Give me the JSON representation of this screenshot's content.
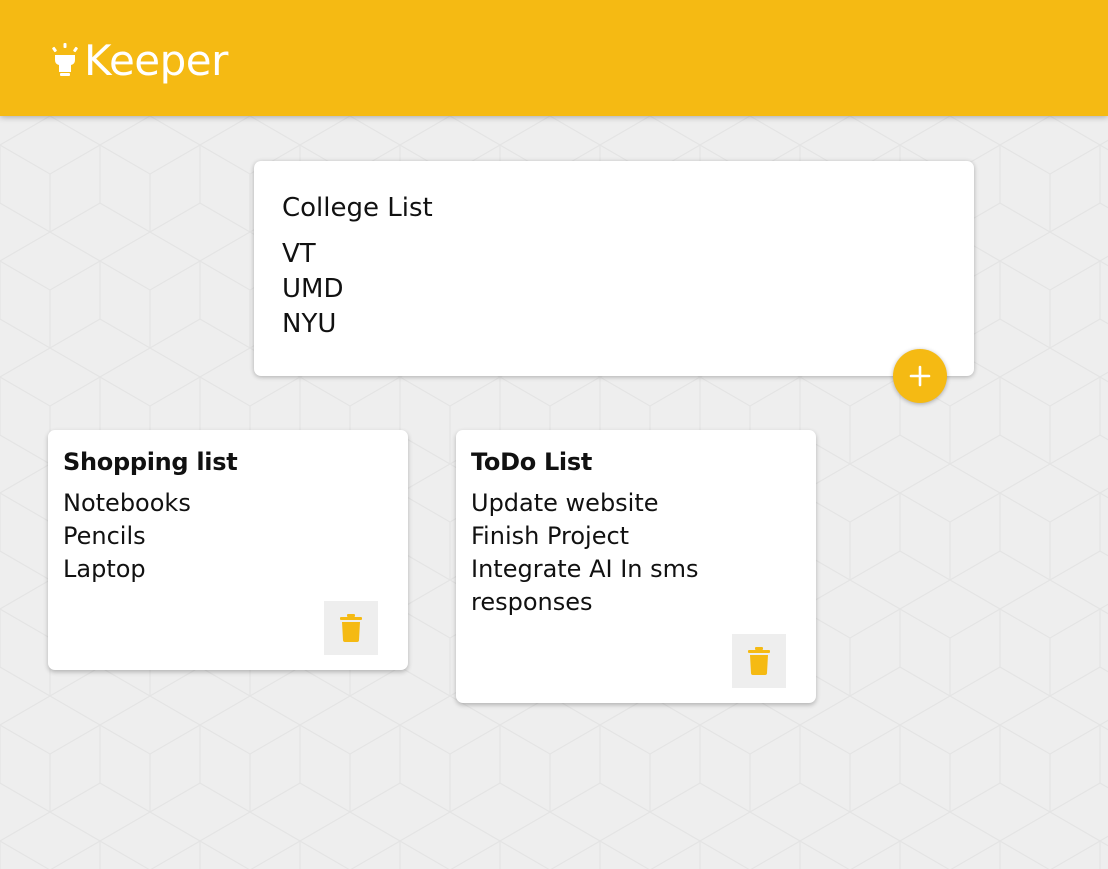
{
  "app": {
    "title": "Keeper",
    "logo_icon": "lightbulb-icon",
    "accent_color": "#f5ba13"
  },
  "compose": {
    "title": "College List",
    "content_lines": [
      "VT",
      "UMD",
      "NYU"
    ],
    "add_icon": "plus-icon"
  },
  "notes": [
    {
      "title": "Shopping list",
      "lines": [
        "Notebooks",
        "Pencils",
        "Laptop"
      ],
      "delete_icon": "trash-icon"
    },
    {
      "title": "ToDo List",
      "lines": [
        "Update website",
        "Finish Project",
        "Integrate AI In sms",
        "responses"
      ],
      "delete_icon": "trash-icon"
    }
  ]
}
